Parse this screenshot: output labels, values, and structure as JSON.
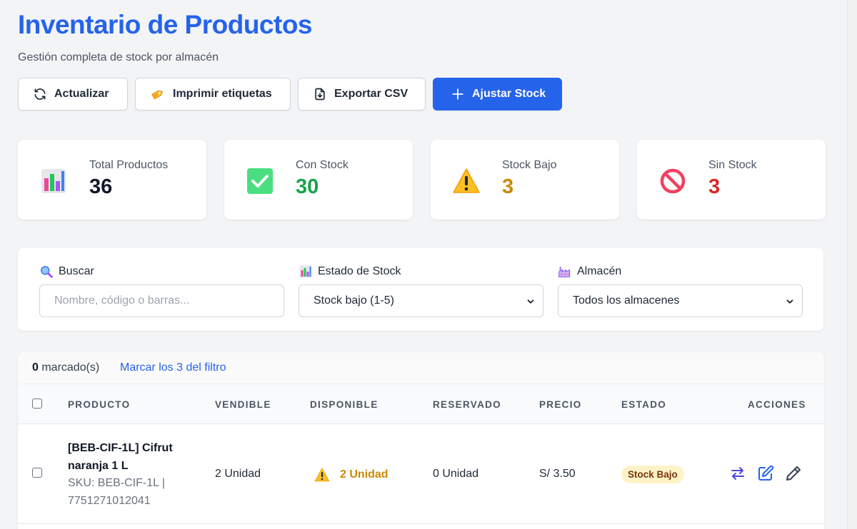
{
  "header": {
    "title": "Inventario de Productos",
    "subtitle": "Gestión completa de stock por almacén"
  },
  "toolbar": {
    "refresh_label": "Actualizar",
    "print_label": "Imprimir etiquetas",
    "export_label": "Exportar CSV",
    "adjust_label": "Ajustar Stock"
  },
  "stats": {
    "total": {
      "label": "Total Productos",
      "value": "36",
      "icon": "bar-chart-icon"
    },
    "in_stock": {
      "label": "Con Stock",
      "value": "30",
      "icon": "check-box-icon",
      "color": "#16a34a"
    },
    "low_stock": {
      "label": "Stock Bajo",
      "value": "3",
      "icon": "warning-icon",
      "color": "#ca8a04"
    },
    "no_stock": {
      "label": "Sin Stock",
      "value": "3",
      "icon": "prohibited-icon",
      "color": "#dc2626"
    }
  },
  "filters": {
    "search": {
      "label": "Buscar",
      "placeholder": "Nombre, código o barras...",
      "value": "",
      "icon": "magnifier-icon"
    },
    "status": {
      "label": "Estado de Stock",
      "value": "Stock bajo (1-5)",
      "icon": "bar-chart-icon"
    },
    "warehouse": {
      "label": "Almacén",
      "value": "Todos los almacenes",
      "icon": "factory-icon"
    }
  },
  "selection": {
    "count": "0",
    "suffix": " marcado(s)",
    "mark_link": "Marcar los 3 del filtro"
  },
  "table": {
    "columns": [
      "Producto",
      "Vendible",
      "Disponible",
      "Reservado",
      "Precio",
      "Estado",
      "Acciones"
    ],
    "rows": [
      {
        "name": "[BEB-CIF-1L] Cifrut naranja 1 L",
        "sku": "SKU: BEB-CIF-1L  |  7751271012041",
        "sellable": "2 Unidad",
        "available": "2 Unidad",
        "reserved": "0 Unidad",
        "price": "S/ 3.50",
        "status": "Stock Bajo",
        "checked": false
      }
    ]
  },
  "colors": {
    "accent": "#2563eb",
    "warning": "#ca8a04",
    "success": "#16a34a",
    "danger": "#dc2626"
  }
}
